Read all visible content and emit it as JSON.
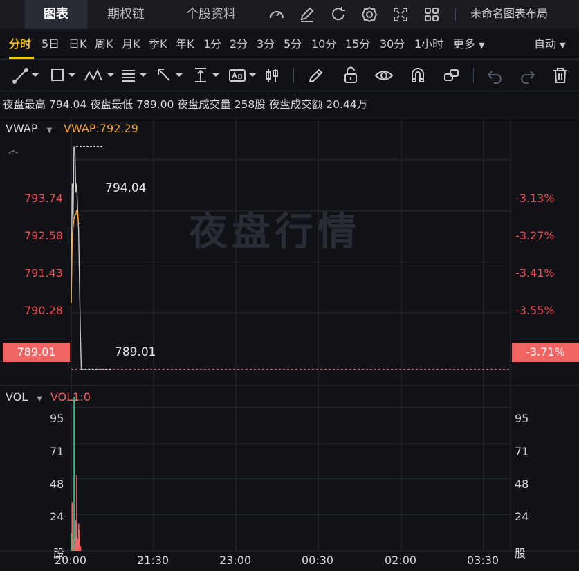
{
  "topbar": {
    "tabs": [
      "图表",
      "期权链",
      "个股资料"
    ],
    "active_tab": 0,
    "layout_label": "未命名图表布局",
    "icons": [
      "gauge-icon",
      "edit-icon",
      "refresh-icon",
      "settings-icon",
      "fullscreen-icon",
      "grid-layout-icon"
    ]
  },
  "periods": {
    "items": [
      "分时",
      "5日",
      "日K",
      "周K",
      "月K",
      "季K",
      "年K",
      "1分",
      "2分",
      "3分",
      "5分",
      "10分",
      "15分",
      "30分",
      "1小时",
      "更多"
    ],
    "active": "分时",
    "mode": "自动"
  },
  "drawing_tools": [
    "line-tool-icon",
    "rectangle-tool-icon",
    "pattern-tool-icon",
    "fib-tool-icon",
    "arrow-tool-icon",
    "measure-tool-icon",
    "text-tool-icon",
    "candle-tool-icon",
    "pencil-icon",
    "lock-icon",
    "eye-icon",
    "magnet-icon",
    "link-icon",
    "undo-icon",
    "redo-icon",
    "trash-icon"
  ],
  "info": {
    "high_label": "夜盘最高",
    "high": "794.04",
    "low_label": "夜盘最低",
    "low": "789.00",
    "vol_label": "夜盘成交量",
    "vol": "258股",
    "amount_label": "夜盘成交额",
    "amount": "20.44万"
  },
  "main_chart": {
    "indicator": "VWAP",
    "indicator_value": "VWAP:792.29",
    "watermark": "夜盘行情",
    "left_ticks": [
      "793.74",
      "792.58",
      "791.43",
      "790.28"
    ],
    "right_ticks": [
      "-3.13%",
      "-3.27%",
      "-3.41%",
      "-3.55%"
    ],
    "current_price": "789.01",
    "current_pct": "-3.71%",
    "high_marker": "794.04",
    "low_marker": "789.01",
    "colors": {
      "price_line": "#c8c8c8",
      "vwap_line": "#f5a623",
      "down": "#f06464",
      "up": "#26c281"
    }
  },
  "volume_chart": {
    "indicator": "VOL",
    "indicator_value": "VOL1:0",
    "ticks": [
      "95",
      "71",
      "48",
      "24"
    ],
    "unit": "股"
  },
  "time_axis": [
    "20:00",
    "21:30",
    "23:00",
    "00:30",
    "02:00",
    "03:30"
  ],
  "chart_data": {
    "type": "line",
    "price_series": {
      "x": [
        "20:00",
        "20:01",
        "20:02",
        "20:03",
        "20:04",
        "20:05",
        "20:06",
        "20:07",
        "20:08",
        "20:09",
        "20:10",
        "20:11",
        "20:12"
      ],
      "y": [
        790.5,
        793.2,
        792.4,
        794.04,
        794.0,
        793.0,
        793.2,
        792.6,
        792.2,
        791.0,
        789.8,
        789.01,
        789.01
      ]
    },
    "vwap_series": {
      "x": [
        "20:00",
        "20:01",
        "20:02",
        "20:03",
        "20:04",
        "20:05",
        "20:06",
        "20:07",
        "20:08",
        "20:09",
        "20:10"
      ],
      "y": [
        790.5,
        791.8,
        792.2,
        792.4,
        792.5,
        792.5,
        792.6,
        792.5,
        792.3,
        792.3,
        792.29
      ]
    },
    "volume_series": {
      "x": [
        "20:00",
        "20:01",
        "20:02",
        "20:03",
        "20:04",
        "20:05",
        "20:06",
        "20:07",
        "20:08",
        "20:09",
        "20:10"
      ],
      "values": [
        12,
        32,
        8,
        102,
        5,
        20,
        50,
        8,
        18,
        14,
        3
      ],
      "colors": [
        "up",
        "down",
        "down",
        "up",
        "down",
        "down",
        "down",
        "down",
        "down",
        "down",
        "down"
      ]
    },
    "ylim": [
      789.0,
      794.3
    ],
    "vol_ylim": [
      0,
      105
    ]
  }
}
